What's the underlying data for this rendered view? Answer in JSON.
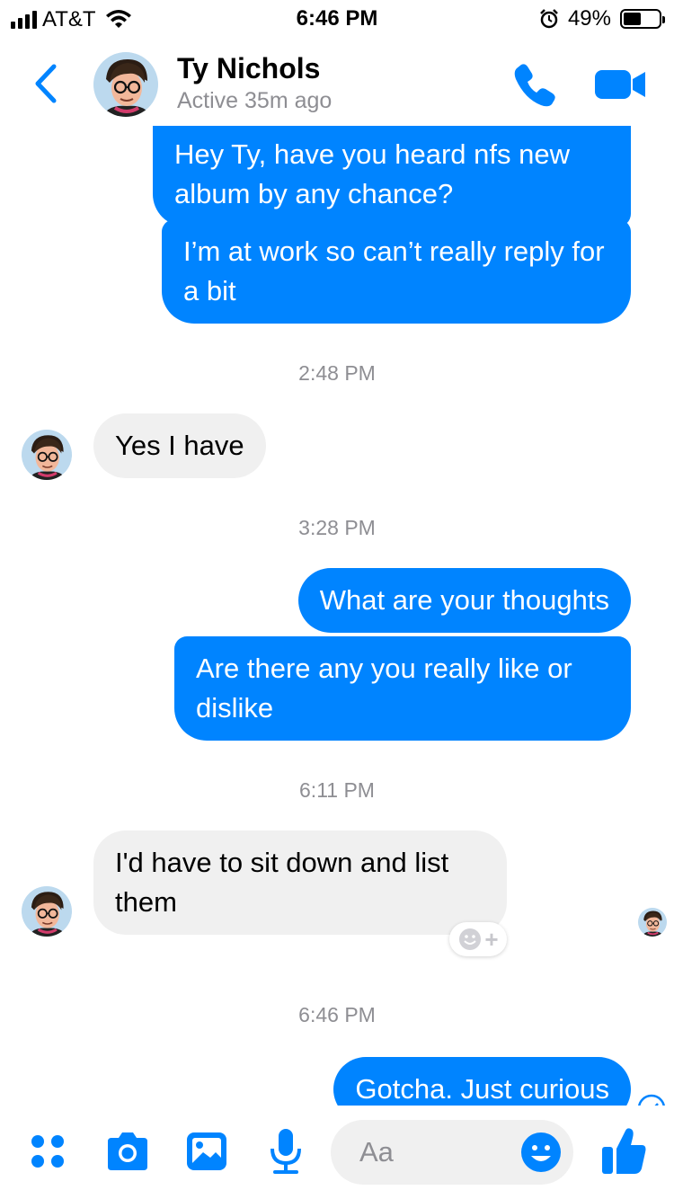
{
  "status_bar": {
    "carrier": "AT&T",
    "time": "6:46 PM",
    "battery": "49%",
    "battery_level": 0.49
  },
  "header": {
    "name": "Ty Nichols",
    "status": "Active 35m ago"
  },
  "messages": {
    "m1": "Hey Ty, have you heard nfs new album by any chance?",
    "m2": "I’m at work so can’t really reply for a bit",
    "t1": "2:48 PM",
    "m3": "Yes I have",
    "t2": "3:28 PM",
    "m4": "What are your thoughts",
    "m5": "Are there any you really like or dislike",
    "t3": "6:11 PM",
    "m6": "I'd have to sit down and list them",
    "t4": "6:46 PM",
    "m7": "Gotcha. Just curious"
  },
  "composer": {
    "placeholder": "Aa"
  },
  "colors": {
    "accent": "#0084ff",
    "incoming_bubble": "#f0f0f0"
  },
  "icons": [
    "signal-icon",
    "wifi-icon",
    "alarm-icon",
    "battery-icon",
    "back-icon",
    "phone-icon",
    "video-icon",
    "apps-icon",
    "camera-icon",
    "photo-icon",
    "mic-icon",
    "emoji-icon",
    "thumbs-up-icon",
    "add-reaction-icon",
    "seen-icon"
  ]
}
